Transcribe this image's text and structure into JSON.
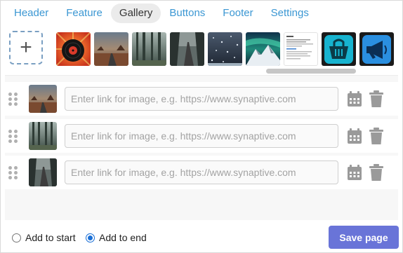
{
  "tabs": [
    "Header",
    "Feature",
    "Gallery",
    "Buttons",
    "Footer",
    "Settings"
  ],
  "active_tab": "Gallery",
  "strip": {
    "add_icon": "plus-icon",
    "add_label": "+",
    "thumbnails": [
      {
        "name": "vinyl-record-thumbnail"
      },
      {
        "name": "desert-road-thumbnail"
      },
      {
        "name": "misty-forest-thumbnail"
      },
      {
        "name": "forest-road-thumbnail"
      },
      {
        "name": "snowy-night-thumbnail"
      },
      {
        "name": "mountain-aurora-thumbnail"
      },
      {
        "name": "document-page-thumbnail"
      },
      {
        "name": "shopping-basket-icon-thumbnail"
      },
      {
        "name": "megaphone-icon-thumbnail"
      }
    ],
    "scroll_position": 0.58
  },
  "rows": [
    {
      "image": "desert-road",
      "link_value": "",
      "placeholder": "Enter link for image, e.g. https://www.synaptive.com"
    },
    {
      "image": "misty-forest",
      "link_value": "",
      "placeholder": "Enter link for image, e.g. https://www.synaptive.com"
    },
    {
      "image": "forest-road",
      "link_value": "",
      "placeholder": "Enter link for image, e.g. https://www.synaptive.com"
    }
  ],
  "footer": {
    "add_options": [
      {
        "label": "Add to start",
        "selected": false
      },
      {
        "label": "Add to end",
        "selected": true
      }
    ],
    "save_label": "Save page"
  },
  "colors": {
    "tab_link": "#3b97d3",
    "save_button": "#6974d8",
    "icon_gray": "#9a9a9a",
    "radio_selected": "#1a6fd6"
  }
}
